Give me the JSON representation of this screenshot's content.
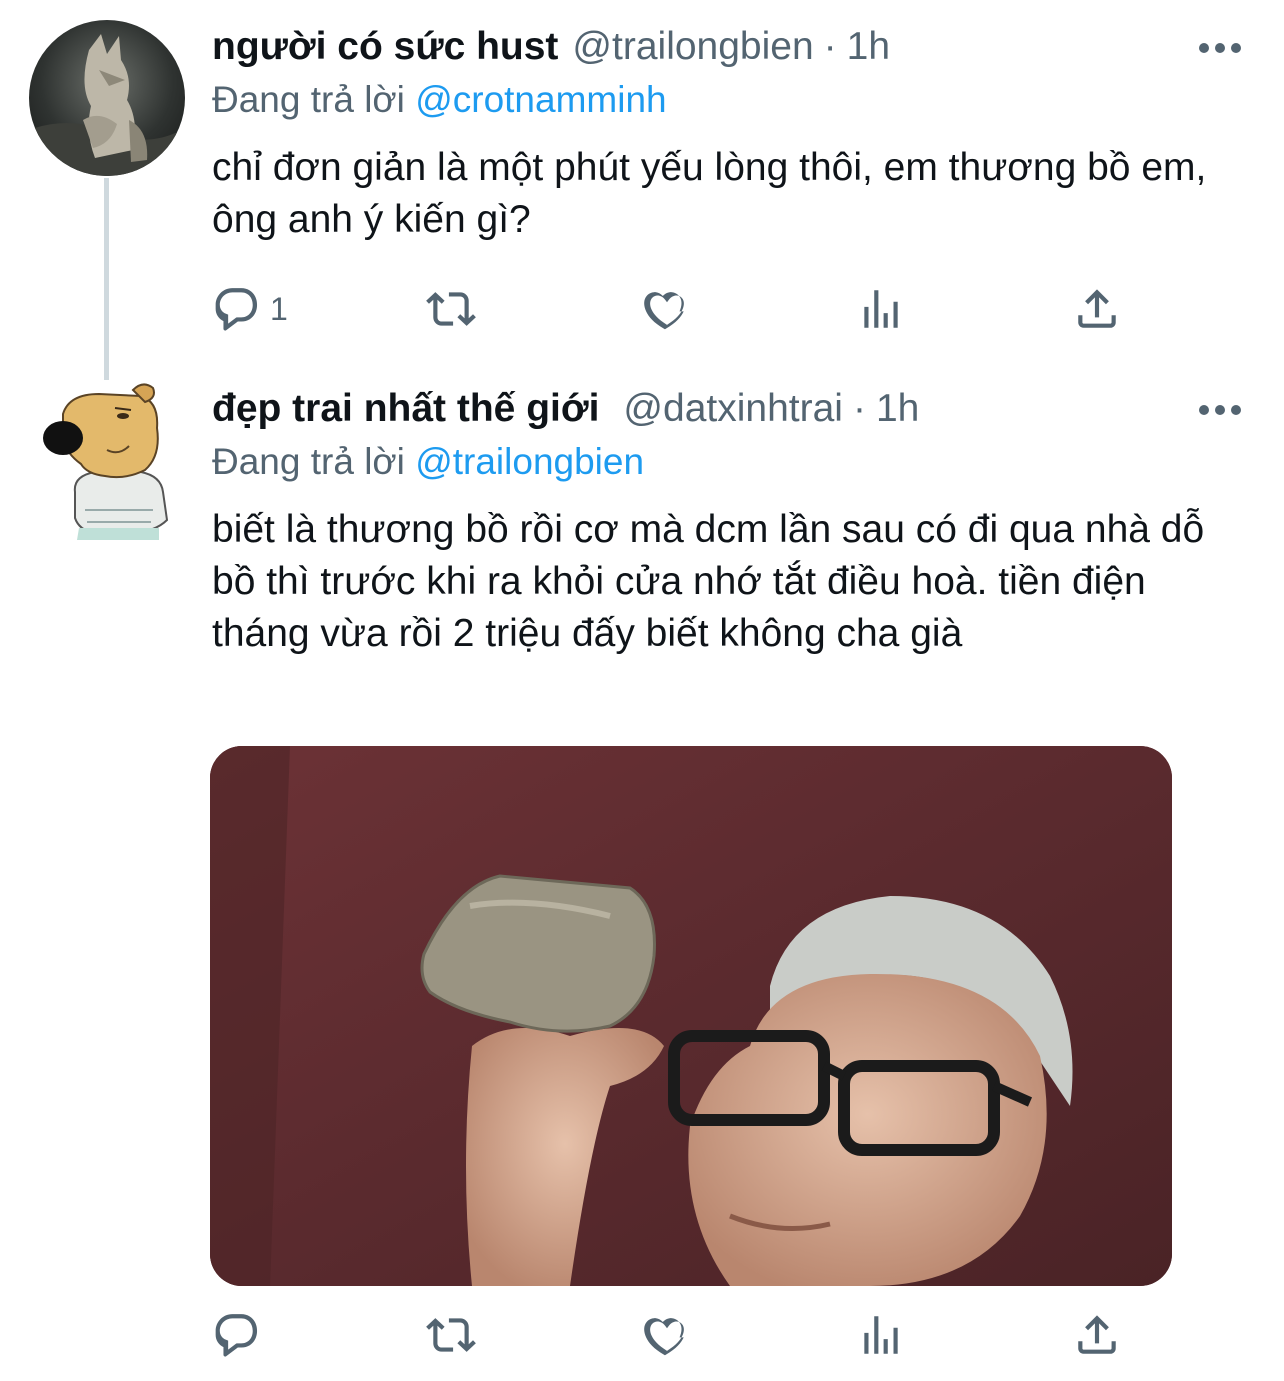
{
  "colors": {
    "link": "#1d9bf0",
    "secondary_text": "#536471",
    "primary_text": "#0f1419",
    "thread_line": "#cfd9de"
  },
  "tweets": [
    {
      "display_name": "người có sức hust",
      "handle": "@trailongbien",
      "separator": "·",
      "time": "1h",
      "replying_prefix": "Đang trả lời",
      "replying_to": "@crotnamminh",
      "text": "chỉ đơn giản là một phút yếu lòng thôi, em thương bồ em, ông anh ý kiến gì?",
      "reply_count": "1",
      "avatar_icon": "wolf-avatar",
      "actions": [
        "reply-icon",
        "retweet-icon",
        "like-icon",
        "views-icon",
        "share-icon"
      ]
    },
    {
      "display_name": "đẹp trai nhất thế giới",
      "handle": "@datxinhtrai",
      "separator": "·",
      "time": "1h",
      "replying_prefix": "Đang trả lời",
      "replying_to": "@trailongbien",
      "text": "biết là thương bồ rồi cơ mà dcm lần sau có đi qua nhà dỗ bồ thì trước khi ra khỏi cửa nhớ tắt điều hoà. tiền điện tháng vừa rồi 2 triệu đấy biết không cha già",
      "reply_count": "",
      "avatar_icon": "cartoon-dog-avatar",
      "media_icon": "man-holding-rock-photo",
      "actions": [
        "reply-icon",
        "retweet-icon",
        "like-icon",
        "views-icon",
        "share-icon"
      ]
    }
  ]
}
